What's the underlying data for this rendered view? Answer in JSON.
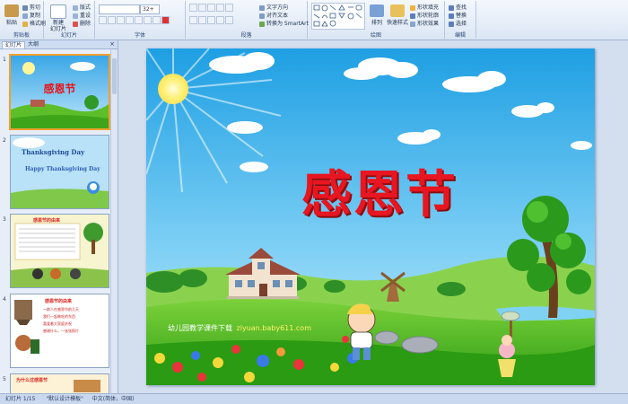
{
  "ribbon": {
    "clipboard": {
      "label": "剪贴板",
      "paste": "粘贴",
      "cut": "剪切",
      "copy": "复制",
      "format_painter": "格式刷"
    },
    "slides": {
      "label": "幻灯片",
      "new_slide": "新建\n幻灯片",
      "layout": "版式",
      "reset": "重设",
      "delete": "删除"
    },
    "font": {
      "label": "字体",
      "size": "32+"
    },
    "paragraph": {
      "label": "段落",
      "text_direction": "文字方向",
      "align_text": "对齐文本",
      "smartart": "转换为 SmartArt"
    },
    "drawing": {
      "label": "绘图",
      "arrange": "排列",
      "quick_styles": "快速样式",
      "shape_fill": "形状填充",
      "shape_outline": "形状轮廓",
      "shape_effects": "形状效果"
    },
    "editing": {
      "label": "编辑",
      "find": "查找",
      "replace": "替换",
      "select": "选择"
    }
  },
  "panel": {
    "tab_slides": "幻灯片",
    "tab_outline": "大纲",
    "close": "×",
    "thumbs": [
      {
        "num": "1",
        "title": "感恩节"
      },
      {
        "num": "2",
        "line1": "Thanksgiving Day",
        "line2": "Happy Thanksgiving Day"
      },
      {
        "num": "3",
        "title": "感恩节的由来"
      },
      {
        "num": "4",
        "title": "感恩节的由来",
        "items": [
          "一群人在感恩节前几天",
          "我们一起做吃的东西",
          "喜爱着大家庭庆祝",
          "感谢什么，一张张照片"
        ]
      },
      {
        "num": "5",
        "title": "为什么过感恩节"
      }
    ]
  },
  "slide": {
    "title": "感恩节",
    "caption": "幼儿园教学课件下载",
    "site": "ziyuan.baby611.com"
  },
  "status": {
    "slide_info": "幻灯片 1/15",
    "theme": "\"默认设计模板\"",
    "language": "中文(简体，中国)"
  }
}
